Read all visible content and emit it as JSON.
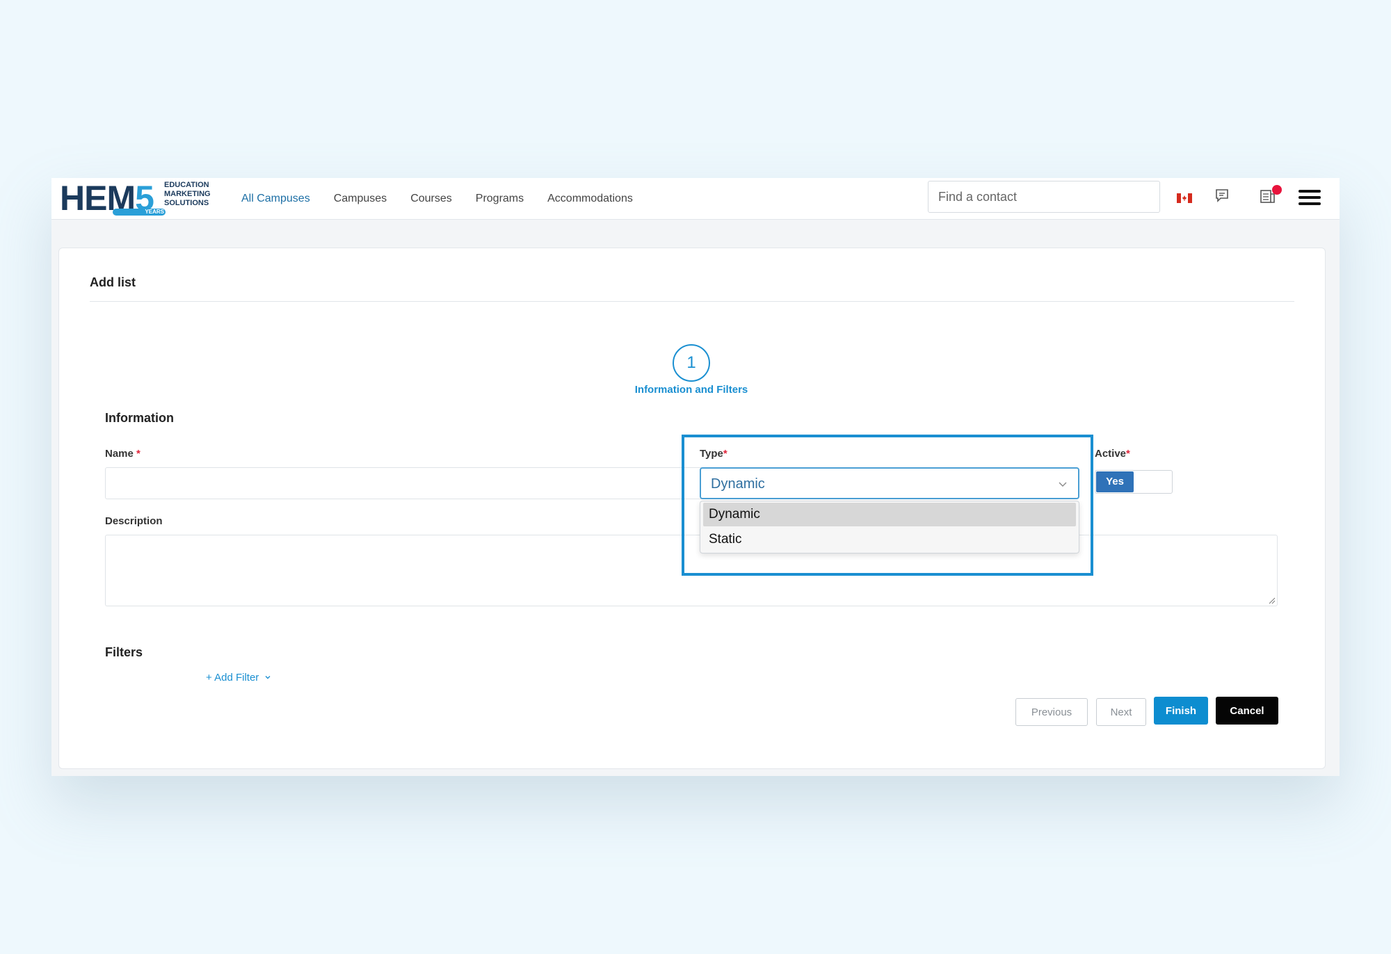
{
  "header": {
    "logo": {
      "letters": "HEM",
      "number": "5",
      "tagline_1": "EDUCATION",
      "tagline_2": "MARKETING",
      "tagline_3": "SOLUTIONS",
      "years": "YEARS"
    },
    "nav": [
      "All Campuses",
      "Campuses",
      "Courses",
      "Programs",
      "Accommodations"
    ],
    "search_placeholder": "Find a contact",
    "icons": [
      "canada-flag-icon",
      "chat-icon",
      "news-icon",
      "hamburger-menu-icon"
    ],
    "accent_color": "#1a8fd1"
  },
  "card": {
    "title": "Add list",
    "step": {
      "number": "1",
      "label": "Information and Filters"
    },
    "information": {
      "section_title": "Information",
      "name_label": "Name",
      "type_label": "Type",
      "type_value": "Dynamic",
      "type_options": [
        "Dynamic",
        "Static"
      ],
      "active_label": "Active",
      "active_value": "Yes",
      "description_label": "Description",
      "required_mark": "*"
    },
    "filters": {
      "section_title": "Filters",
      "add_filter": "+ Add Filter"
    },
    "buttons": {
      "previous": "Previous",
      "next": "Next",
      "finish": "Finish",
      "cancel": "Cancel"
    }
  }
}
